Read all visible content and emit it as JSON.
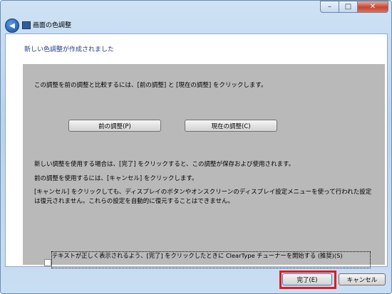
{
  "window": {
    "title": "画面の色調整",
    "controls": {
      "minimize": "–",
      "maximize": "□",
      "close": "✕"
    },
    "back_icon": "back-arrow-icon"
  },
  "heading": "新しい色調整が作成されました",
  "compare_text": "この調整を前の調整と比較するには、[前の調整] と [現在の調整] をクリックします。",
  "buttons": {
    "previous": "前の調整(P)",
    "current": "現在の調整(C)",
    "finish": "完了(E)",
    "cancel": "キャンセル"
  },
  "info": {
    "line1": "新しい調整を使用する場合は、[完了] をクリックすると、この調整が保存および使用されます。",
    "line2": "前の調整を使用するには、[キャンセル] をクリックします。",
    "line3a": "[キャンセル] をクリックしても、ディスプレイのボタンやオンスクリーンのディスプレイ設定メニューを使って行われた設定は復元されません。これらの設定を自動的に復元することはできません。"
  },
  "checkbox": {
    "checked": false,
    "label": "テキストが正しく表示されるよう、[完了] をクリックしたときに ClearType チューナーを開始する (推奨)(S)"
  },
  "colors": {
    "highlight": "#e41919",
    "heading": "#1f3d96",
    "panel_gray": "#b9b9b9"
  }
}
